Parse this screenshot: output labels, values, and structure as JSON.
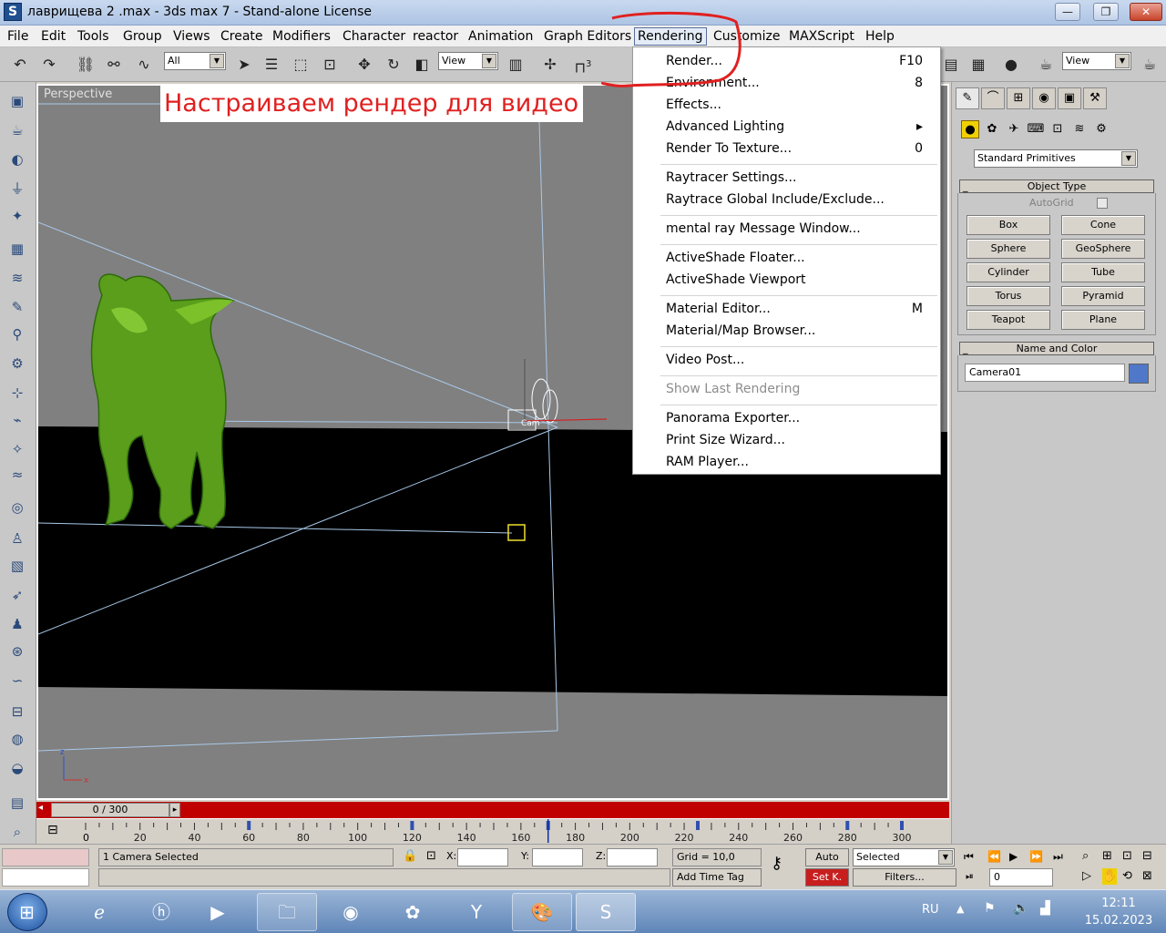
{
  "window": {
    "title": "лаврищева 2 .max - 3ds max 7  - Stand-alone License",
    "app_icon_letter": "S",
    "buttons": {
      "minimize": "—",
      "maximize": "❐",
      "close": "✕"
    }
  },
  "menubar": {
    "items": [
      "File",
      "Edit",
      "Tools",
      "Group",
      "Views",
      "Create",
      "Modifiers",
      "Character",
      "reactor",
      "Animation",
      "Graph Editors",
      "Rendering",
      "Customize",
      "MAXScript",
      "Help"
    ],
    "active": "Rendering"
  },
  "toolbar": {
    "selection_filter": "All",
    "ref_coord_left": "View",
    "ref_coord_right": "View",
    "snap_label": "3"
  },
  "viewport": {
    "label": "Perspective",
    "annotation": "Настраиваем рендер для видео",
    "camera_tag": "Cam"
  },
  "rendering_menu": {
    "groups": [
      [
        {
          "label": "Render...",
          "shortcut": "F10"
        },
        {
          "label": "Environment...",
          "shortcut": "8"
        },
        {
          "label": "Effects...",
          "shortcut": ""
        },
        {
          "label": "Advanced Lighting",
          "shortcut": "▸"
        },
        {
          "label": "Render To Texture...",
          "shortcut": "0"
        }
      ],
      [
        {
          "label": "Raytracer Settings...",
          "shortcut": ""
        },
        {
          "label": "Raytrace Global Include/Exclude...",
          "shortcut": ""
        }
      ],
      [
        {
          "label": "mental ray Message Window...",
          "shortcut": ""
        }
      ],
      [
        {
          "label": "ActiveShade Floater...",
          "shortcut": ""
        },
        {
          "label": "ActiveShade Viewport",
          "shortcut": ""
        }
      ],
      [
        {
          "label": "Material Editor...",
          "shortcut": "M"
        },
        {
          "label": "Material/Map Browser...",
          "shortcut": ""
        }
      ],
      [
        {
          "label": "Video Post...",
          "shortcut": ""
        }
      ],
      [
        {
          "label": "Show Last Rendering",
          "shortcut": "",
          "disabled": true
        }
      ],
      [
        {
          "label": "Panorama Exporter...",
          "shortcut": ""
        },
        {
          "label": "Print Size Wizard...",
          "shortcut": ""
        },
        {
          "label": "RAM Player...",
          "shortcut": ""
        }
      ]
    ]
  },
  "command_panel": {
    "category": "Standard Primitives",
    "object_type_header": "Object Type",
    "autogrid_label": "AutoGrid",
    "primitives": [
      "Box",
      "Cone",
      "Sphere",
      "GeoSphere",
      "Cylinder",
      "Tube",
      "Torus",
      "Pyramid",
      "Teapot",
      "Plane"
    ],
    "name_color_header": "Name and Color",
    "object_name": "Camera01",
    "object_color": "#4f78c8",
    "rollout_minus": "_"
  },
  "timeline": {
    "frame_box": "0 / 300",
    "ruler_labels": [
      "20",
      "40",
      "60",
      "80",
      "100",
      "120",
      "140",
      "160",
      "180",
      "200",
      "220",
      "240",
      "260",
      "280",
      "300"
    ],
    "first_tick_label": "0",
    "current_frame": 170,
    "key_frames": [
      60,
      120,
      170,
      225,
      280,
      300
    ]
  },
  "statusbar": {
    "selection_text": "1 Camera Selected",
    "x_label": "X:",
    "y_label": "Y:",
    "z_label": "Z:",
    "grid_text": "Grid = 10,0",
    "add_time_tag": "Add Time Tag",
    "auto_key": "Auto",
    "set_key": "Set K.",
    "selected_dropdown": "Selected",
    "filters": "Filters...",
    "frame_field": "0"
  },
  "taskbar": {
    "language": "RU",
    "time": "12:11",
    "date": "15.02.2023"
  }
}
